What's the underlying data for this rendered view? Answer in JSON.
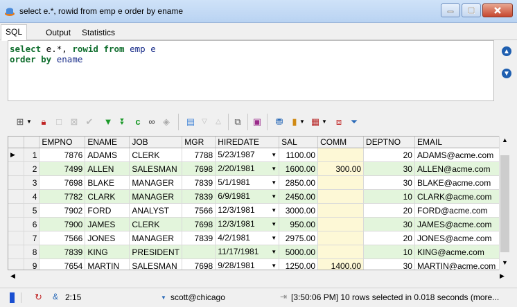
{
  "window": {
    "title": "select e.*, rowid from emp e order by ename"
  },
  "tabs": [
    {
      "label": "SQL"
    },
    {
      "label": "Output"
    },
    {
      "label": "Statistics"
    }
  ],
  "editor": {
    "line1": {
      "kw1": "select",
      "rest1": " e.*, ",
      "kw2": "rowid",
      "sp": " ",
      "kw3": "from",
      "rest2": " emp e"
    },
    "line2": {
      "kw1": "order by",
      "rest": " ename"
    }
  },
  "grid": {
    "columns": [
      "EMPNO",
      "ENAME",
      "JOB",
      "MGR",
      "HIREDATE",
      "SAL",
      "COMM",
      "DEPTNO",
      "EMAIL"
    ],
    "rows": [
      [
        "1",
        "7876",
        "ADAMS",
        "CLERK",
        "7788",
        "5/23/1987",
        "1100.00",
        "",
        "20",
        "ADAMS@acme.com"
      ],
      [
        "2",
        "7499",
        "ALLEN",
        "SALESMAN",
        "7698",
        "2/20/1981",
        "1600.00",
        "300.00",
        "30",
        "ALLEN@acme.com"
      ],
      [
        "3",
        "7698",
        "BLAKE",
        "MANAGER",
        "7839",
        "5/1/1981",
        "2850.00",
        "",
        "30",
        "BLAKE@acme.com"
      ],
      [
        "4",
        "7782",
        "CLARK",
        "MANAGER",
        "7839",
        "6/9/1981",
        "2450.00",
        "",
        "10",
        "CLARK@acme.com"
      ],
      [
        "5",
        "7902",
        "FORD",
        "ANALYST",
        "7566",
        "12/3/1981",
        "3000.00",
        "",
        "20",
        "FORD@acme.com"
      ],
      [
        "6",
        "7900",
        "JAMES",
        "CLERK",
        "7698",
        "12/3/1981",
        "950.00",
        "",
        "30",
        "JAMES@acme.com"
      ],
      [
        "7",
        "7566",
        "JONES",
        "MANAGER",
        "7839",
        "4/2/1981",
        "2975.00",
        "",
        "20",
        "JONES@acme.com"
      ],
      [
        "8",
        "7839",
        "KING",
        "PRESIDENT",
        "",
        "11/17/1981",
        "5000.00",
        "",
        "10",
        "KING@acme.com"
      ],
      [
        "9",
        "7654",
        "MARTIN",
        "SALESMAN",
        "7698",
        "9/28/1981",
        "1250.00",
        "1400.00",
        "30",
        "MARTIN@acme.com"
      ]
    ]
  },
  "status": {
    "position": "2:15",
    "connection": "scott@chicago",
    "message": "[3:50:06 PM] 10 rows selected in 0.018 seconds (more..."
  }
}
